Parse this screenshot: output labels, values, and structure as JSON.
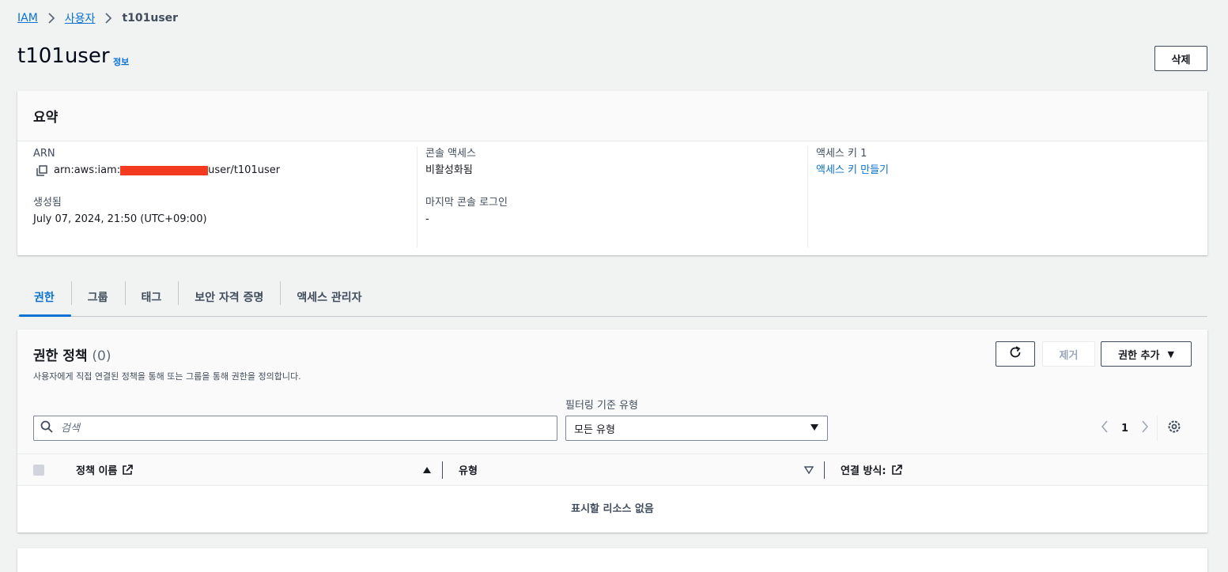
{
  "breadcrumb": {
    "root": "IAM",
    "users": "사용자",
    "current": "t101user"
  },
  "page": {
    "title": "t101user",
    "info": "정보",
    "delete_label": "삭제"
  },
  "summary": {
    "title": "요약",
    "arn_label": "ARN",
    "arn_prefix": "arn:aws:iam:",
    "arn_suffix": "user/t101user",
    "created_label": "생성됨",
    "created_value": "July 07, 2024, 21:50 (UTC+09:00)",
    "console_access_label": "콘솔 액세스",
    "console_access_value": "비활성화됨",
    "last_login_label": "마지막 콘솔 로그인",
    "last_login_value": "-",
    "access_key_label": "액세스 키 1",
    "access_key_link": "액세스 키 만들기"
  },
  "tabs": [
    {
      "label": "권한",
      "active": true
    },
    {
      "label": "그룹"
    },
    {
      "label": "태그"
    },
    {
      "label": "보안 자격 증명"
    },
    {
      "label": "액세스 관리자"
    }
  ],
  "permissions": {
    "title": "권한 정책",
    "count": "(0)",
    "description": "사용자에게 직접 연결된 정책을 통해 또는 그룹을 통해 권한을 정의합니다.",
    "remove_label": "제거",
    "add_label": "권한 추가",
    "filter_label": "필터링 기준 유형",
    "search_placeholder": "검색",
    "filter_value": "모든 유형",
    "page": "1",
    "columns": {
      "name": "정책 이름",
      "type": "유형",
      "attached_via": "연결 방식:"
    },
    "empty": "표시할 리소스 없음"
  },
  "colors": {
    "link": "#0972d3",
    "redaction": "#f43a1f"
  },
  "icons": [
    "chevron-right-icon",
    "copy-icon",
    "refresh-icon",
    "caret-down-icon",
    "search-icon",
    "external-link-icon",
    "sort-ascending-icon",
    "sort-icon",
    "settings-icon",
    "chevron-left-icon"
  ]
}
